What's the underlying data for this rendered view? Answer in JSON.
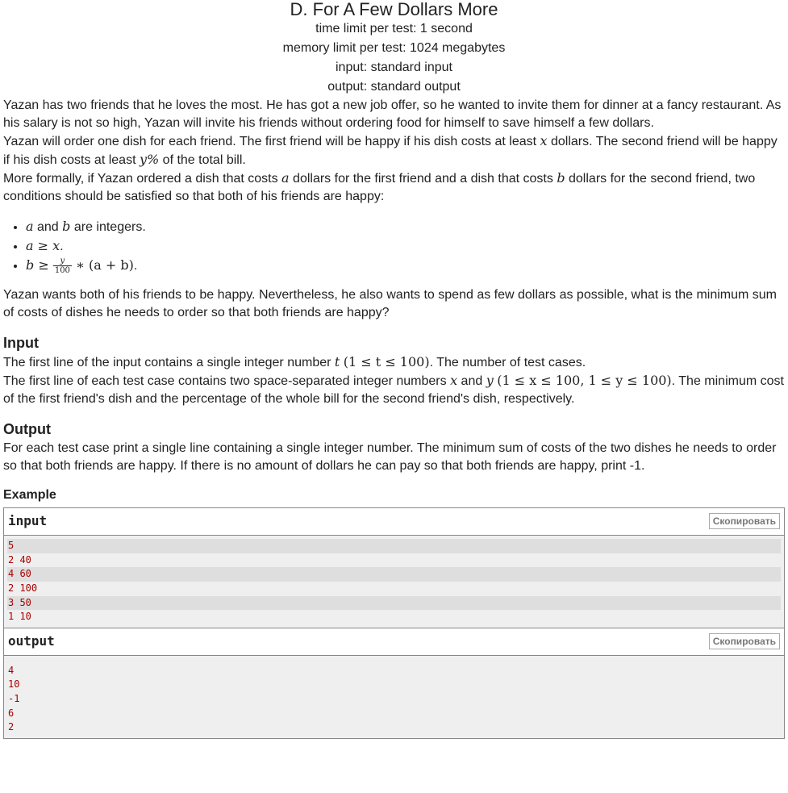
{
  "problem": {
    "title": "D. For A Few Dollars More",
    "time_limit": "time limit per test: 1 second",
    "memory_limit": "memory limit per test: 1024 megabytes",
    "input": "input: standard input",
    "output": "output: standard output"
  },
  "statement": {
    "p1": "Yazan has two friends that he loves the most. He has got a new job offer, so he wanted to invite them for dinner at a fancy restaurant. As his salary is not so high, Yazan will invite his friends without ordering food for himself to save himself a few dollars.",
    "p2_a": "Yazan will order one dish for each friend. The first friend will be happy if his dish costs at least ",
    "p2_x": "x",
    "p2_b": " dollars. The second friend will be happy if his dish costs at least ",
    "p2_y": "y%",
    "p2_c": " of the total bill.",
    "p3_a": "More formally, if Yazan ordered a dish that costs ",
    "p3_av": "a",
    "p3_b": " dollars for the first friend and a dish that costs ",
    "p3_bv": "b",
    "p3_c": " dollars for the second friend, two conditions should be satisfied so that both of his friends are happy:",
    "cond1_a": "a",
    "cond1_and": " and ",
    "cond1_b": "b",
    "cond1_rest": " are integers.",
    "cond2": "a ≥ x",
    "cond3_lhs": "b ≥ ",
    "cond3_num": "y",
    "cond3_den": "100",
    "cond3_rhs": " ∗ (a + b)",
    "p4": "Yazan wants both of his friends to be happy. Nevertheless, he also wants to spend as few dollars as possible, what is the minimum sum of costs of dishes he needs to order so that both friends are happy?"
  },
  "input_section": {
    "title": "Input",
    "p1_a": "The first line of the input contains a single integer number ",
    "p1_t": "t",
    "p1_range": "(1 ≤ t ≤ 100)",
    "p1_b": ". The number of test cases.",
    "p2_a": "The first line of each test case contains two space-separated integer numbers ",
    "p2_x": "x",
    "p2_and": " and ",
    "p2_y": "y",
    "p2_range": "(1 ≤ x ≤ 100, 1 ≤ y ≤ 100)",
    "p2_b": ". The minimum cost of the first friend's dish and the percentage of the whole bill for the second friend's dish, respectively."
  },
  "output_section": {
    "title": "Output",
    "p1": "For each test case print a single line containing a single integer number. The minimum sum of costs of the two dishes he needs to order so that both friends are happy. If there is no amount of dollars he can pay so that both friends are happy, print -1."
  },
  "example": {
    "title": "Example",
    "copy_label": "Скопировать",
    "input_label": "input",
    "input_lines": [
      "5",
      "2 40",
      "4 60",
      "2 100",
      "3 50",
      "1 10"
    ],
    "output_label": "output",
    "output_lines": [
      "4",
      "10",
      "-1",
      "6",
      "2"
    ]
  }
}
